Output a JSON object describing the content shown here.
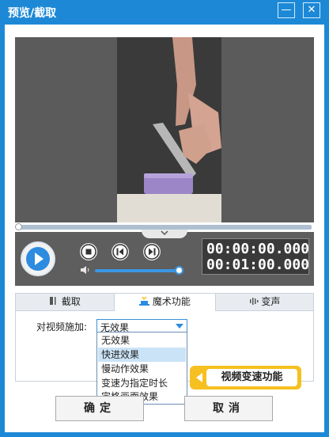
{
  "window": {
    "title": "预览/截取",
    "minimize_label": "—",
    "close_label": "✕",
    "accent": "#1d89d6"
  },
  "player": {
    "current_time": "00:00:00.000",
    "total_time": "00:01:00.000",
    "progress": 0.0,
    "volume": 1.0,
    "icons": [
      "play-icon",
      "stop-icon",
      "prev-frame-icon",
      "next-frame-icon",
      "volume-icon",
      "chevron-down-icon"
    ]
  },
  "tabs": [
    {
      "label": "截取",
      "icon": "crop-icon"
    },
    {
      "label": "魔术功能",
      "icon": "magic-hat-icon",
      "active": true
    },
    {
      "label": "变声",
      "icon": "voice-icon"
    }
  ],
  "effect": {
    "label": "对视频施加:",
    "selected": "无效果",
    "options": [
      "无效果",
      "快进效果",
      "慢动作效果",
      "变速为指定时长",
      "定格画面效果"
    ],
    "highlighted_index": 1
  },
  "callout": {
    "text": "视频变速功能",
    "color": "#f6c021"
  },
  "buttons": {
    "ok": "确定",
    "cancel": "取消"
  }
}
